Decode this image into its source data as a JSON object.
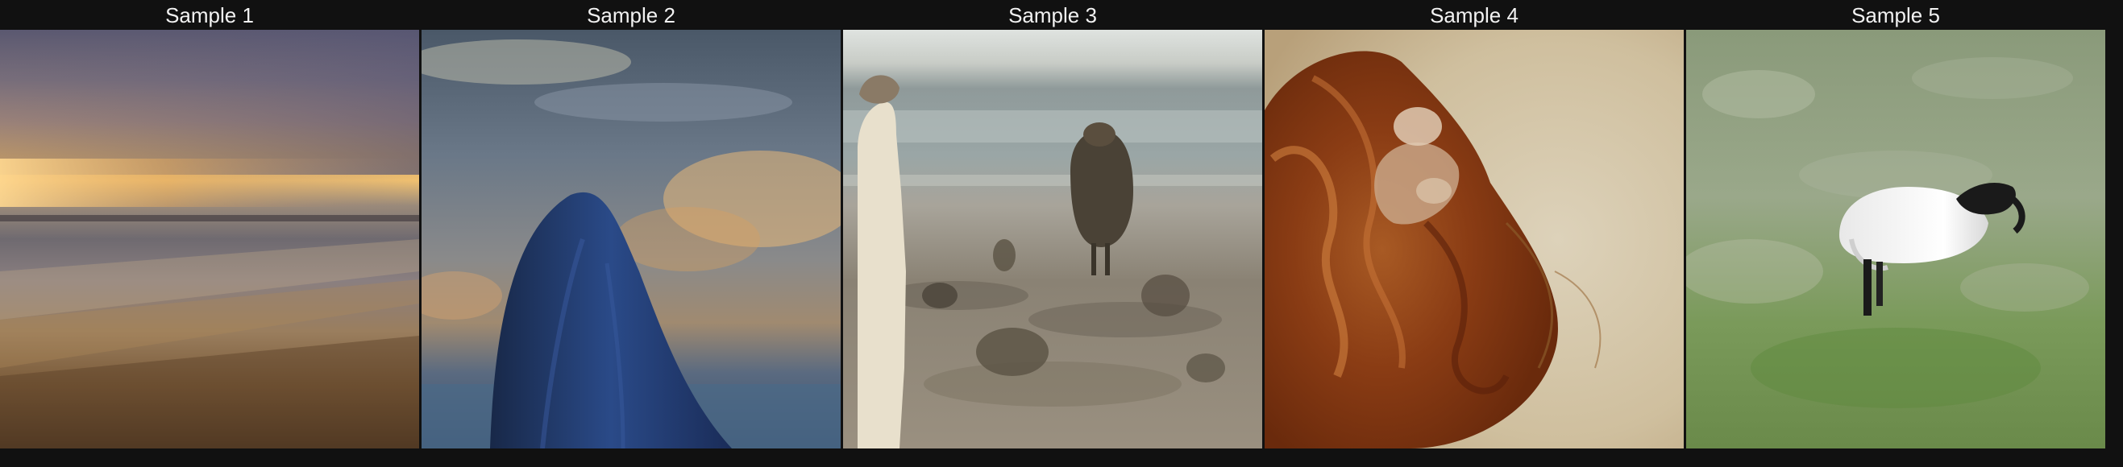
{
  "samples": [
    {
      "title": "Sample 1",
      "depicts": "blurred-sunset-seascape"
    },
    {
      "title": "Sample 2",
      "depicts": "blue-hooded-figure-under-clouds"
    },
    {
      "title": "Sample 3",
      "depicts": "figures-on-rocky-beach"
    },
    {
      "title": "Sample 4",
      "depicts": "red-hair-portrait-sketch"
    },
    {
      "title": "Sample 5",
      "depicts": "white-bird-in-grass"
    }
  ],
  "colors": {
    "background": "#111111",
    "title_text": "#f2f2f2"
  }
}
